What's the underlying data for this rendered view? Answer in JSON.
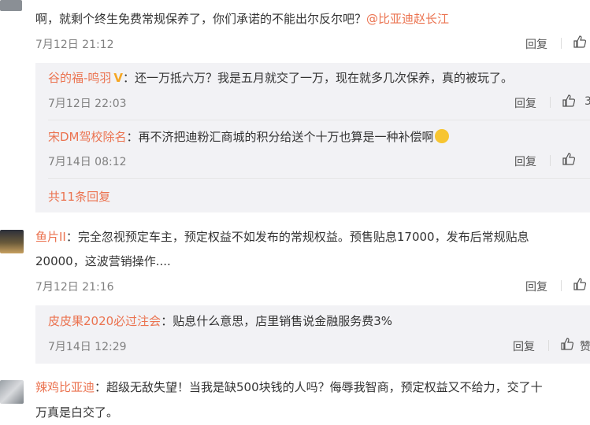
{
  "comment1": {
    "text_a": "啊，就剩个终生免费常规保养了，你们承诺的不能出尔反尔吧？",
    "mention": "@比亚迪赵长江",
    "time": "7月12日 21:12",
    "reply": "回复"
  },
  "sub1": {
    "user": "谷的福-鸣羽",
    "badge": "V",
    "text": "：还一万抵六万？我是五月就交了一万，现在就多几次保养，真的被玩了。",
    "time": "7月12日 22:03",
    "reply": "回复",
    "like_cut": "3"
  },
  "sub2": {
    "user": "宋DM驾校除名",
    "text": "：再不济把迪粉汇商城的积分给送个十万也算是一种补偿啊",
    "time": "7月14日 08:12",
    "reply": "回复"
  },
  "more_replies": "共11条回复",
  "comment2": {
    "user": "鱼片II",
    "text_line1": "：完全忽视预定车主，预定权益不如发布的常规权益。预售贴息17000，发布后常规贴息",
    "text_line2": "20000，这波营销操作....",
    "time": "7月12日 21:16",
    "reply": "回复"
  },
  "sub3": {
    "user": "皮皮果2020必过注会",
    "text": "：贴息什么意思，店里销售说金融服务费3%",
    "time": "7月14日 12:29",
    "reply": "回复",
    "like_cut": "赞"
  },
  "comment3": {
    "user": "辣鸡比亚迪",
    "text_line1": "：超级无敌失望！当我是缺500块钱的人吗？侮辱我智商，预定权益又不给力，交了十",
    "text_line2": "万真是白交了。"
  },
  "colors": {
    "link": "#eb7350",
    "time": "#808080",
    "subbg": "#f2f2f5"
  }
}
